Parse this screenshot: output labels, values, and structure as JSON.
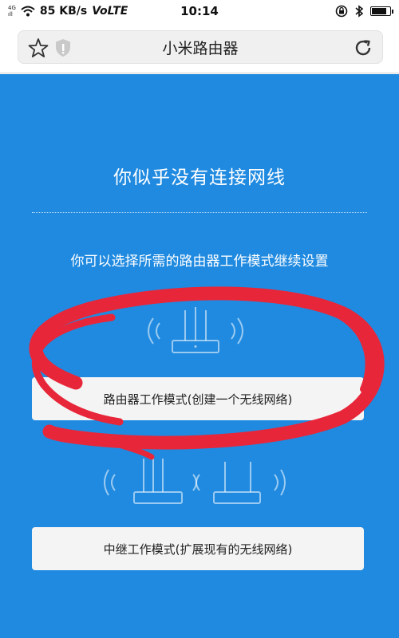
{
  "status_bar": {
    "network_type": "4G",
    "network_sub": "ıll",
    "speed": "85 KB/s",
    "volte": "VoLTE",
    "time": "10:14",
    "battery_level": 0.85
  },
  "browser": {
    "title": "小米路由器"
  },
  "main": {
    "headline": "你似乎没有连接网线",
    "subtext": "你可以选择所需的路由器工作模式继续设置",
    "router_mode_label": "路由器工作模式(创建一个无线网络)",
    "relay_mode_label": "中继工作模式(扩展现有的无线网络)"
  },
  "colors": {
    "panel_blue": "#1f8ae0",
    "annotation_red": "#e8263a",
    "button_bg": "#f4f4f4"
  },
  "icons": {
    "favorite": "star-icon",
    "security": "shield-icon",
    "refresh": "reload-icon",
    "router": "router-wifi-icon",
    "relay": "relay-router-icon"
  }
}
